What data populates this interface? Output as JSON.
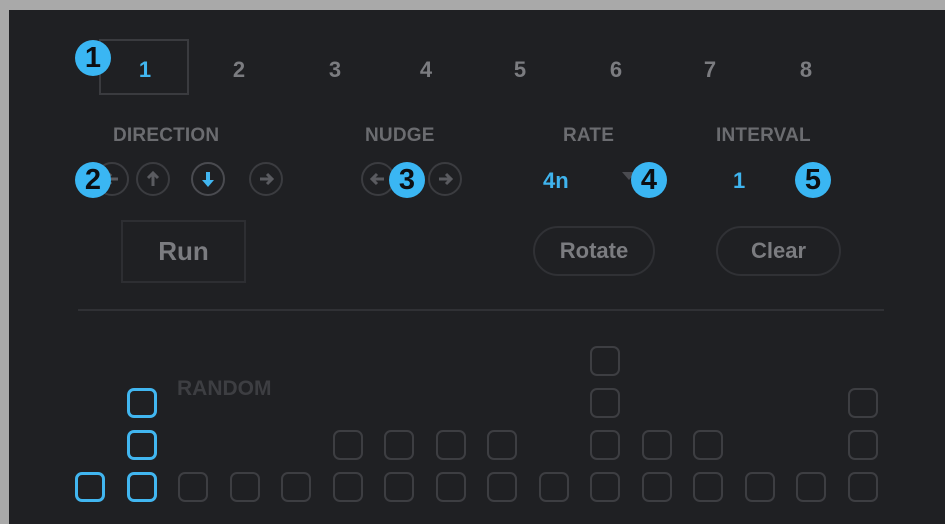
{
  "tabs": [
    "1",
    "2",
    "3",
    "4",
    "5",
    "6",
    "7",
    "8"
  ],
  "active_tab": "1",
  "badges": [
    "1",
    "2",
    "3",
    "4",
    "5"
  ],
  "labels": {
    "direction": "DIRECTION",
    "nudge": "NUDGE",
    "rate": "RATE",
    "interval": "INTERVAL",
    "random": "RANDOM"
  },
  "direction_buttons": [
    "arrow-left",
    "arrow-up",
    "arrow-down",
    "arrow-right"
  ],
  "direction_selected": "arrow-down",
  "rate_value": "4n",
  "interval_value": "1",
  "buttons": {
    "run": "Run",
    "rotate": "Rotate",
    "clear": "Clear"
  },
  "grid": {
    "columns": 16,
    "rows": 4,
    "visible_cells_per_column": [
      1,
      3,
      1,
      1,
      1,
      2,
      2,
      2,
      2,
      1,
      4,
      2,
      2,
      1,
      1,
      3
    ],
    "active_cells_per_column": [
      1,
      3,
      0,
      0,
      0,
      0,
      0,
      0,
      0,
      0,
      0,
      0,
      0,
      0,
      0,
      0
    ]
  },
  "colors": {
    "accent": "#41b6f0",
    "background": "#1f2023",
    "frame": "#a9a9a9",
    "muted_text": "#7b7c80",
    "inactive_cell": "#3d3e42"
  }
}
